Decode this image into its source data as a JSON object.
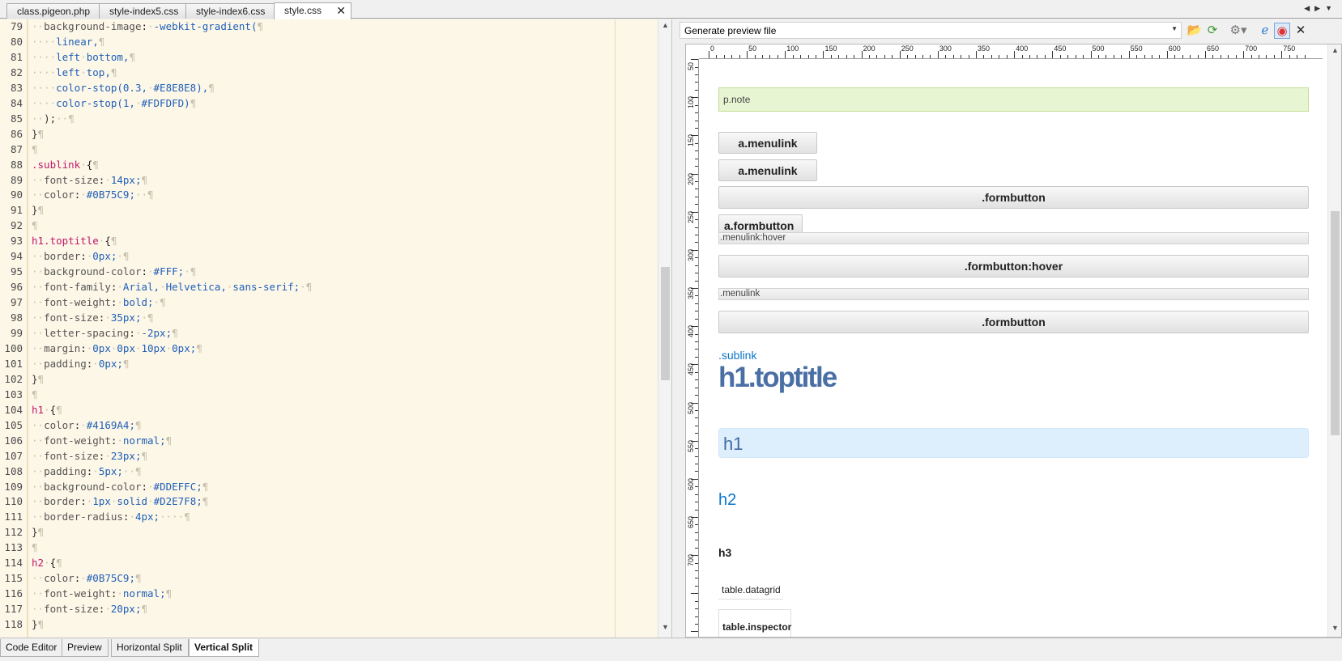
{
  "file_tabs": [
    {
      "label": "class.pigeon.php",
      "active": false
    },
    {
      "label": "style-index5.css",
      "active": false
    },
    {
      "label": "style-index6.css",
      "active": false
    },
    {
      "label": "style.css",
      "active": true
    }
  ],
  "editor": {
    "lines": [
      {
        "n": "79",
        "code": "··background-image:·-webkit-gradient(¶"
      },
      {
        "n": "80",
        "code": "····linear,¶"
      },
      {
        "n": "81",
        "code": "····left·bottom,¶"
      },
      {
        "n": "82",
        "code": "····left·top,¶"
      },
      {
        "n": "83",
        "code": "····color-stop(0.3,·#E8E8E8),¶"
      },
      {
        "n": "84",
        "code": "····color-stop(1,·#FDFDFD)¶"
      },
      {
        "n": "85",
        "code": "··);··¶"
      },
      {
        "n": "86",
        "code": "}¶"
      },
      {
        "n": "87",
        "code": "¶"
      },
      {
        "n": "88",
        "code": ".sublink·{¶"
      },
      {
        "n": "89",
        "code": "··font-size:·14px;¶"
      },
      {
        "n": "90",
        "code": "··color:·#0B75C9;··¶"
      },
      {
        "n": "91",
        "code": "}¶"
      },
      {
        "n": "92",
        "code": "¶"
      },
      {
        "n": "93",
        "code": "h1.toptitle·{¶"
      },
      {
        "n": "94",
        "code": "··border:·0px;·¶"
      },
      {
        "n": "95",
        "code": "··background-color:·#FFF;·¶"
      },
      {
        "n": "96",
        "code": "··font-family:·Arial,·Helvetica,·sans-serif;·¶"
      },
      {
        "n": "97",
        "code": "··font-weight:·bold;·¶"
      },
      {
        "n": "98",
        "code": "··font-size:·35px;·¶"
      },
      {
        "n": "99",
        "code": "··letter-spacing:·-2px;¶"
      },
      {
        "n": "100",
        "code": "··margin:·0px·0px·10px·0px;¶"
      },
      {
        "n": "101",
        "code": "··padding:·0px;¶"
      },
      {
        "n": "102",
        "code": "}¶"
      },
      {
        "n": "103",
        "code": "¶"
      },
      {
        "n": "104",
        "code": "h1·{¶"
      },
      {
        "n": "105",
        "code": "··color:·#4169A4;¶"
      },
      {
        "n": "106",
        "code": "··font-weight:·normal;¶"
      },
      {
        "n": "107",
        "code": "··font-size:·23px;¶"
      },
      {
        "n": "108",
        "code": "··padding:·5px;··¶"
      },
      {
        "n": "109",
        "code": "··background-color:·#DDEFFC;¶"
      },
      {
        "n": "110",
        "code": "··border:·1px·solid·#D2E7F8;¶"
      },
      {
        "n": "111",
        "code": "··border-radius:·4px;····¶"
      },
      {
        "n": "112",
        "code": "}¶"
      },
      {
        "n": "113",
        "code": "¶"
      },
      {
        "n": "114",
        "code": "h2·{¶"
      },
      {
        "n": "115",
        "code": "··color:·#0B75C9;¶"
      },
      {
        "n": "116",
        "code": "··font-weight:·normal;¶"
      },
      {
        "n": "117",
        "code": "··font-size:·20px;¶"
      },
      {
        "n": "118",
        "code": "}¶"
      }
    ]
  },
  "preview": {
    "generate_label": "Generate preview file",
    "toolbar_icons": [
      "folder-open-icon",
      "refresh-icon",
      "gear-icon",
      "ie-icon",
      "chrome-icon",
      "close-icon"
    ],
    "ruler_h": [
      "0",
      "50",
      "100",
      "150",
      "200",
      "250",
      "300",
      "350",
      "400",
      "450",
      "500",
      "550",
      "600",
      "650",
      "700",
      "750"
    ],
    "ruler_v": [
      "50",
      "100",
      "150",
      "200",
      "250",
      "300",
      "350",
      "400",
      "450",
      "500",
      "550",
      "600",
      "650",
      "700"
    ],
    "items": {
      "note": "p.note",
      "menulink1": "a.menulink",
      "menulink2": "a.menulink",
      "formbutton1": ".formbutton",
      "aformbutton": "a.formbutton",
      "menulink_hover": ".menulink:hover",
      "formbutton_hover": ".formbutton:hover",
      "menulink3": ".menulink",
      "formbutton2": ".formbutton",
      "sublink": ".sublink",
      "toptitle": "h1.toptitle",
      "h1": "h1",
      "h2": "h2",
      "h3": "h3",
      "datagrid": "table.datagrid",
      "inspector": "table.inspector"
    }
  },
  "bottom_tabs": [
    {
      "label": "Code Editor",
      "active": false
    },
    {
      "label": "Preview",
      "active": false
    },
    {
      "label": "Horizontal Split",
      "active": false
    },
    {
      "label": "Vertical Split",
      "active": true
    }
  ],
  "colors": {
    "editor_bg": "#FDF7E8",
    "selector": "#C0186A",
    "value": "#1F5FB8",
    "sublink": "#0B75C9",
    "h1_text": "#4169A4",
    "h1_bg": "#DDEFFC",
    "note_bg": "#E8F5D2"
  }
}
